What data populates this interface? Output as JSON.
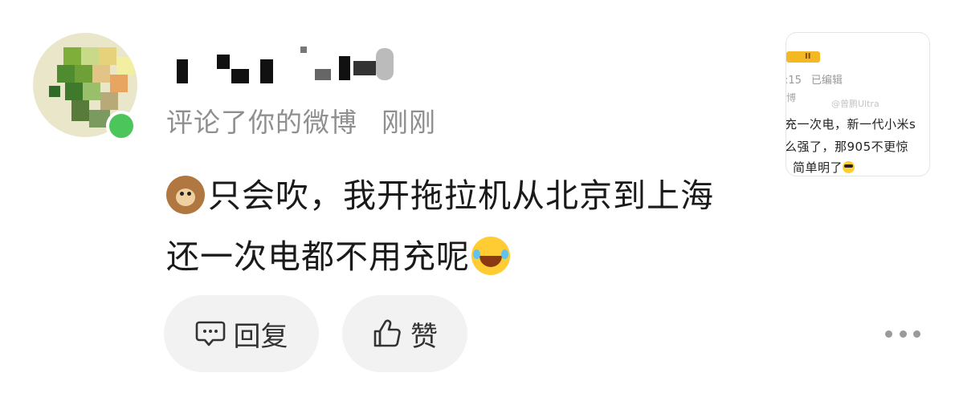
{
  "notification": {
    "username": "",
    "action_text": "评论了你的微博",
    "time_text": "刚刚",
    "comment": {
      "line1": "只会吹，我开拖拉机从北京到上海",
      "line2": "还一次电都不用充呢",
      "leading_emoji": "monkey-icon",
      "trailing_emoji": "laughing-crying-icon"
    }
  },
  "actions": {
    "reply_label": "回复",
    "like_label": "赞",
    "reply_icon": "comment-bubble-icon",
    "like_icon": "thumbs-up-icon",
    "more_icon": "more-dots-icon"
  },
  "preview": {
    "badge_text": "II",
    "meta_time": ":15",
    "meta_edited": "已编辑",
    "mark": "博",
    "watermark": "@曾鹏Ultra",
    "line1": "充一次电，新一代小米s",
    "line2": "么强了，那905不更惊",
    "line3": "简单明了"
  },
  "colors": {
    "online_dot": "#4cc55a",
    "button_bg": "#f2f2f2",
    "subtitle": "#8f8f8f",
    "badge": "#f3b823"
  }
}
